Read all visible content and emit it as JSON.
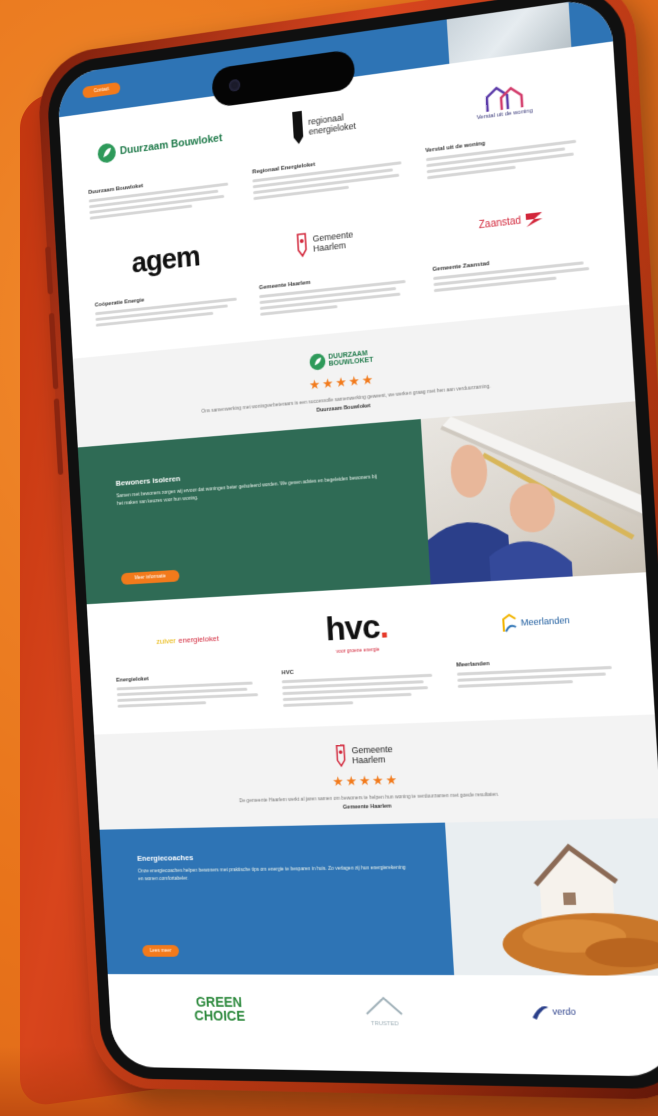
{
  "topbar": {
    "button_label": "Contact"
  },
  "partners_row1": [
    {
      "logo": "Duurzaam Bouwloket",
      "title": "Duurzaam Bouwloket"
    },
    {
      "logo": "regionaal energieloket",
      "title": "Regionaal Energieloket"
    },
    {
      "logo": "Verstal uit de woning",
      "title": "Verstal uit de woning"
    }
  ],
  "partners_row2": [
    {
      "logo": "agem",
      "title": "Coöperatie Energie"
    },
    {
      "logo": "Gemeente Haarlem",
      "title": "Gemeente Haarlem"
    },
    {
      "logo": "Zaanstad",
      "title": "Gemeente Zaanstad"
    }
  ],
  "review1": {
    "logo_line1": "DUURZAAM",
    "logo_line2": "BOUWLOKET",
    "stars": "★★★★★",
    "text": "Ons samenwerking met woningverbeteraars is een succesvolle samenwerking geweest, we werken graag met hen aan verduurzaming.",
    "author": "Duurzaam Bouwloket"
  },
  "feature1": {
    "title": "Bewoners isoleren",
    "body": "Samen met bewoners zorgen wij ervoor dat woningen beter geïsoleerd worden. We geven advies en begeleiden bewoners bij het maken van keuzes voor hun woning.",
    "button": "Meer informatie",
    "color": "#2f6b55"
  },
  "partners_row3": [
    {
      "logo_a": "zuiver",
      "logo_b": "energieloket",
      "title": "Energieloket"
    },
    {
      "logo": "hvc",
      "logo_sub": "voor groene energie",
      "title": "HVC"
    },
    {
      "logo": "Meerlanden",
      "title": "Meerlanden"
    }
  ],
  "review2": {
    "logo_line1": "Gemeente",
    "logo_line2": "Haarlem",
    "stars": "★★★★★",
    "text": "De gemeente Haarlem werkt al jaren samen om bewoners te helpen hun woning te verduurzamen met goede resultaten.",
    "author": "Gemeente Haarlem"
  },
  "feature2": {
    "title": "Energiecoaches",
    "body": "Onze energiecoaches helpen bewoners met praktische tips om energie te besparen in huis. Zo verlagen zij hun energierekening en wonen comfortabeler.",
    "button": "Lees meer",
    "color": "#2e74b5"
  },
  "bottom_logos": [
    {
      "line1": "GREEN",
      "line2": "CHOICE"
    },
    {
      "label": "TRUSTED"
    },
    {
      "label": "verdo"
    }
  ],
  "colors": {
    "orange": "#f27a1b",
    "green": "#2f6b55",
    "blue": "#2e74b5"
  }
}
